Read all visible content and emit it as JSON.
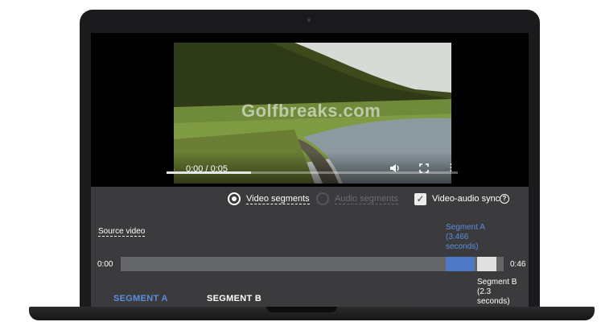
{
  "player": {
    "watermark": "Golfbreaks.com",
    "time_display": "0:00 / 0:05",
    "progress_fraction": 0.29,
    "icons": [
      "play-icon",
      "volume-icon",
      "fullscreen-icon",
      "more-vert-icon"
    ]
  },
  "editor": {
    "modes": [
      {
        "label": "Video segments",
        "selected": true
      },
      {
        "label": "Audio segments",
        "selected": false
      }
    ],
    "sync": {
      "label": "Video-audio sync",
      "checked": true,
      "check_glyph": "✓",
      "help_glyph": "?"
    },
    "source_label": "Source video",
    "timeline": {
      "start_label": "0:00",
      "end_label": "0:46",
      "segment_a_caption": "Segment A (3.466 seconds)",
      "segment_b_caption": "Segment B (2.3 seconds)"
    },
    "tabs": [
      {
        "label": "SEGMENT A",
        "active": true
      },
      {
        "label": "SEGMENT B",
        "active": false
      }
    ]
  },
  "colors": {
    "accent_blue": "#5b8de0",
    "panel_bg": "#3b3b3e",
    "segment_a": "#4f79c6",
    "segment_b": "#e0e0e0"
  }
}
